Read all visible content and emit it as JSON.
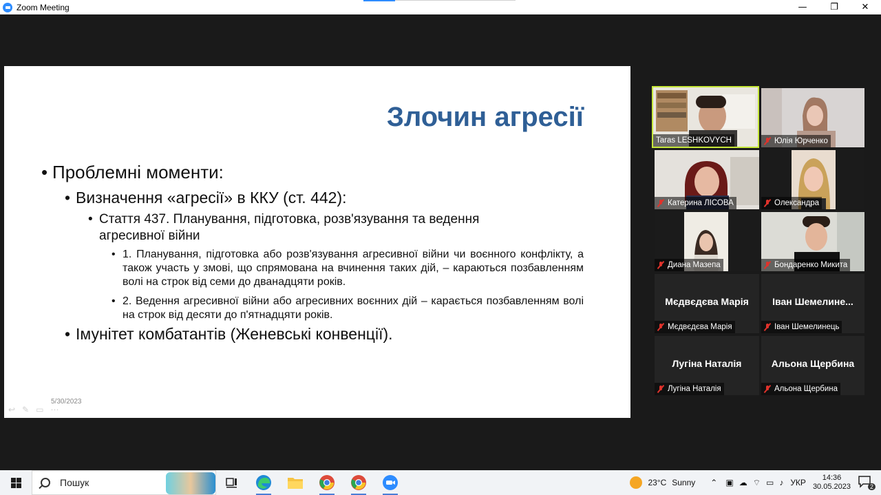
{
  "window": {
    "title": "Zoom Meeting",
    "minimize": "—",
    "maximize": "❐",
    "close": "✕"
  },
  "slide": {
    "title": "Злочин агресії",
    "bullet1": "Проблемні моменти:",
    "bullet2": "Визначення «агресії» в ККУ (ст. 442):",
    "bullet3": "Стаття 437. Планування, підготовка, розв'язування та ведення агресивної війни",
    "bullet4a": "1. Планування, підготовка або розв'язування агресивної війни чи воєнного конфлікту, а також участь у змові, що спрямована на вчинення таких дій, – караються позбавленням волі на строк від семи до дванадцяти років.",
    "bullet4b": "2. Ведення агресивної війни або агресивних воєнних дій – карається позбавленням волі на строк від десяти до п'ятнадцяти років.",
    "bullet5": "Імунітет комбатантів (Женевські конвенції).",
    "date": "5/30/2023",
    "bullet_char": "•"
  },
  "participants": [
    {
      "name": "Taras LESHKOVYCH",
      "muted": false,
      "video": true,
      "active": true
    },
    {
      "name": "Юлія Юрченко",
      "muted": true,
      "video": true
    },
    {
      "name": "Катерина ЛІСОВА",
      "muted": true,
      "video": true
    },
    {
      "name": "Олександра",
      "muted": true,
      "video": true
    },
    {
      "name": "Диана Мазепа",
      "muted": true,
      "video": true
    },
    {
      "name": "Бондаренко Микита",
      "muted": true,
      "video": true
    },
    {
      "name": "Мєдвєдєва Марія",
      "display": "Мєдвєдєва Марія",
      "muted": true,
      "video": false
    },
    {
      "name": "Іван Шемелинець",
      "display": "Іван  Шемелине...",
      "muted": true,
      "video": false
    },
    {
      "name": "Лугіна Наталія",
      "display": "Лугіна Наталія",
      "muted": true,
      "video": false
    },
    {
      "name": "Альона Щербина",
      "display": "Альона Щербина",
      "muted": true,
      "video": false
    }
  ],
  "taskbar": {
    "search_placeholder": "Пошук",
    "temperature": "23°C",
    "weather": "Sunny",
    "language": "УКР",
    "time": "14:36",
    "date": "30.05.2023",
    "notifications": "2"
  },
  "colors": {
    "title_blue": "#2f5f96",
    "active_speaker": "#c6e83a",
    "muted_red": "#e0322b"
  }
}
